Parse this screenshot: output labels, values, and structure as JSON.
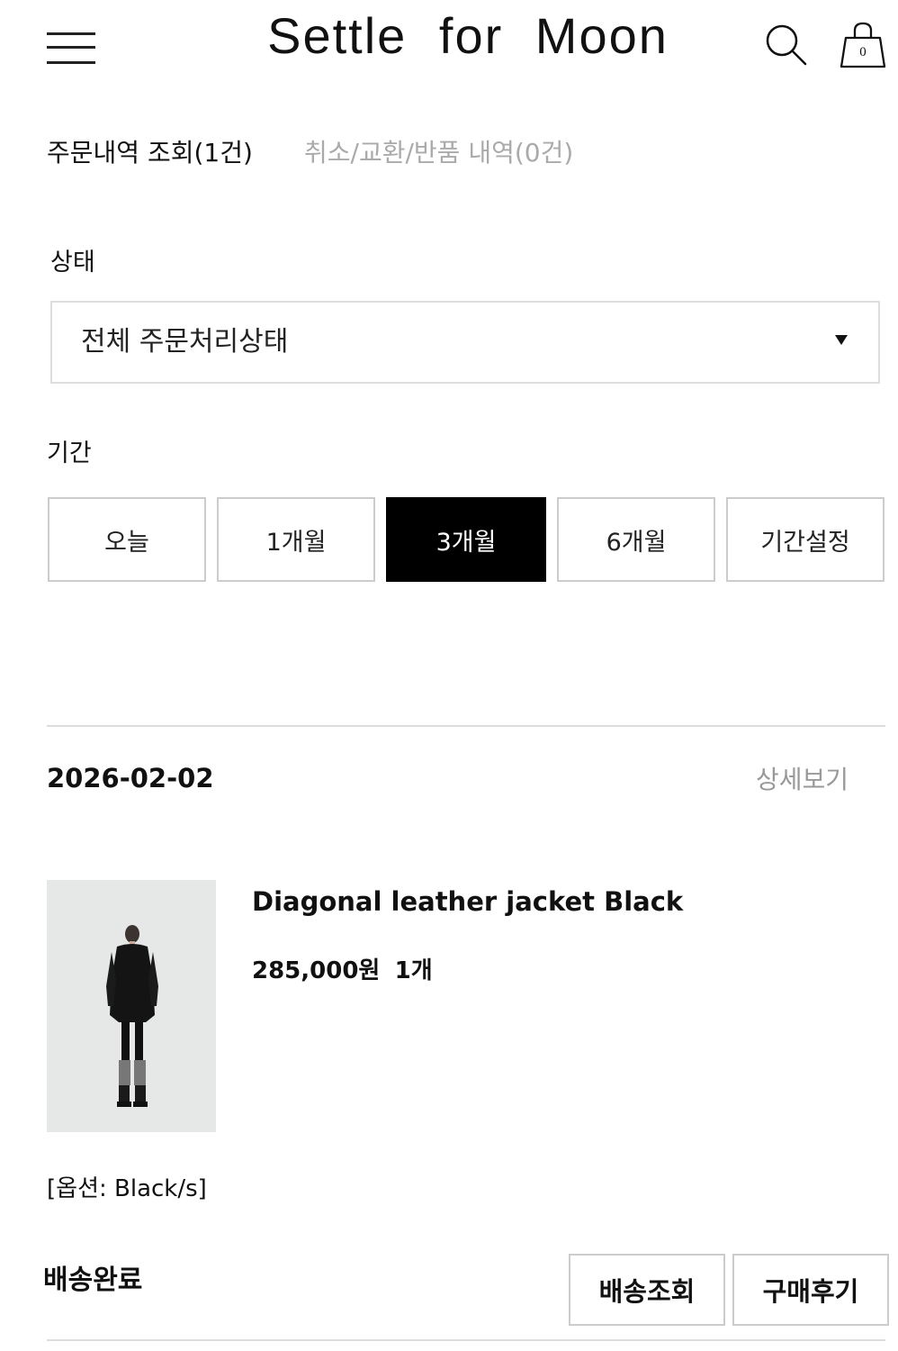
{
  "header": {
    "brand": "Settle for Moon",
    "cart_count": "0"
  },
  "tabs": {
    "orders": "주문내역 조회(1건)",
    "returns": "취소/교환/반품 내역(0건)"
  },
  "filters": {
    "status_label": "상태",
    "status_value": "전체 주문처리상태",
    "period_label": "기간",
    "periods": [
      "오늘",
      "1개월",
      "3개월",
      "6개월",
      "기간설정"
    ],
    "active_period": "3개월"
  },
  "order": {
    "date": "2026-02-02",
    "detail_link": "상세보기",
    "product_name": "Diagonal leather jacket Black",
    "price": "285,000원",
    "quantity": "1개",
    "option": "[옵션: Black/s]",
    "shipping_status": "배송완료",
    "track_button": "배송조회",
    "review_button": "구매후기"
  }
}
